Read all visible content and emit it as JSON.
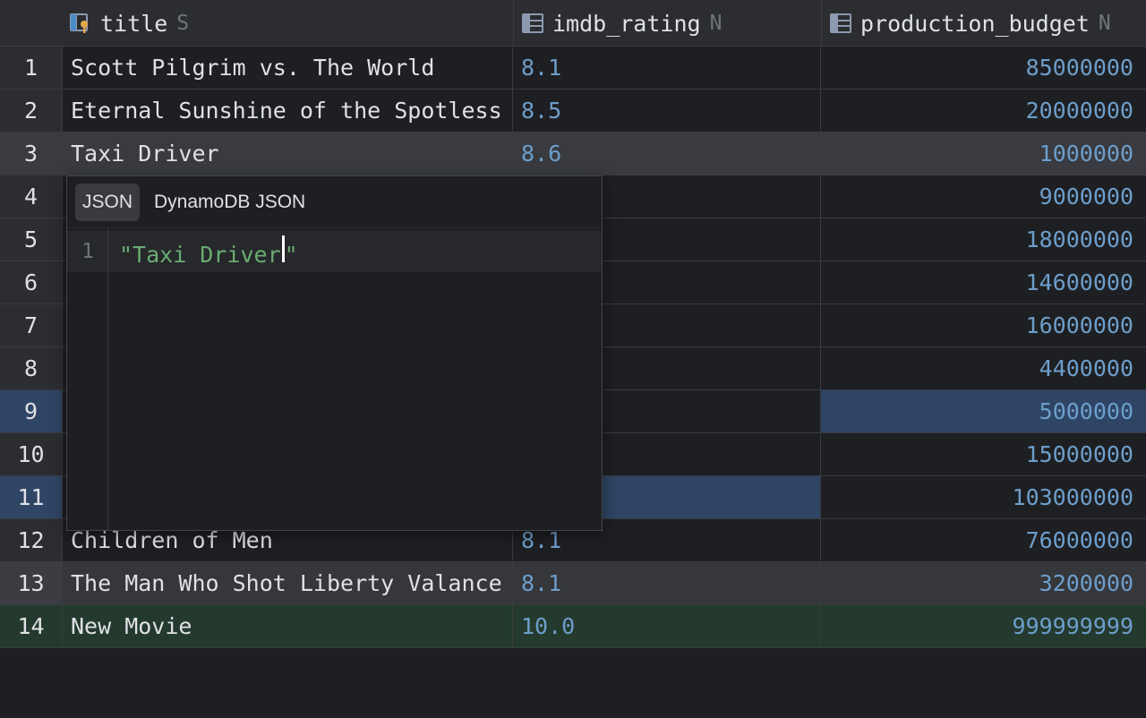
{
  "columns": [
    {
      "name": "title",
      "type": "S",
      "icon": "key-column-icon"
    },
    {
      "name": "imdb_rating",
      "type": "N",
      "icon": "column-icon"
    },
    {
      "name": "production_budget",
      "type": "N",
      "icon": "column-icon"
    }
  ],
  "rows": [
    {
      "n": "1",
      "title": "Scott Pilgrim vs. The World",
      "rating": "8.1",
      "budget": "85000000"
    },
    {
      "n": "2",
      "title": "Eternal Sunshine of the Spotless Mind",
      "rating": "8.5",
      "budget": "20000000"
    },
    {
      "n": "3",
      "title": "Taxi Driver",
      "rating": "8.6",
      "budget": "1000000"
    },
    {
      "n": "4",
      "title": "",
      "rating": "",
      "budget": "9000000"
    },
    {
      "n": "5",
      "title": "",
      "rating": "",
      "budget": "18000000"
    },
    {
      "n": "6",
      "title": "",
      "rating": "",
      "budget": "14600000"
    },
    {
      "n": "7",
      "title": "",
      "rating": "",
      "budget": "16000000"
    },
    {
      "n": "8",
      "title": "",
      "rating": "",
      "budget": "4400000"
    },
    {
      "n": "9",
      "title": "",
      "rating": "",
      "budget": "5000000"
    },
    {
      "n": "10",
      "title": "",
      "rating": "",
      "budget": "15000000"
    },
    {
      "n": "11",
      "title": "",
      "rating": "",
      "budget": "103000000"
    },
    {
      "n": "12",
      "title": "Children of Men",
      "rating": "8.1",
      "budget": "76000000"
    },
    {
      "n": "13",
      "title": "The Man Who Shot Liberty Valance",
      "rating": "8.1",
      "budget": "3200000"
    },
    {
      "n": "14",
      "title": "New Movie",
      "rating": "10.0",
      "budget": "999999999"
    }
  ],
  "popup": {
    "tabs": [
      "JSON",
      "DynamoDB JSON"
    ],
    "active_tab": "JSON",
    "line_number": "1",
    "code": "\"Taxi Driver\""
  },
  "colors": {
    "background": "#1e1f22",
    "selected_cell": "#2e5a7c",
    "selected_row": "#2f4565",
    "new_row": "#243a2e",
    "number": "#6d9ecb",
    "string": "#6aab73"
  }
}
